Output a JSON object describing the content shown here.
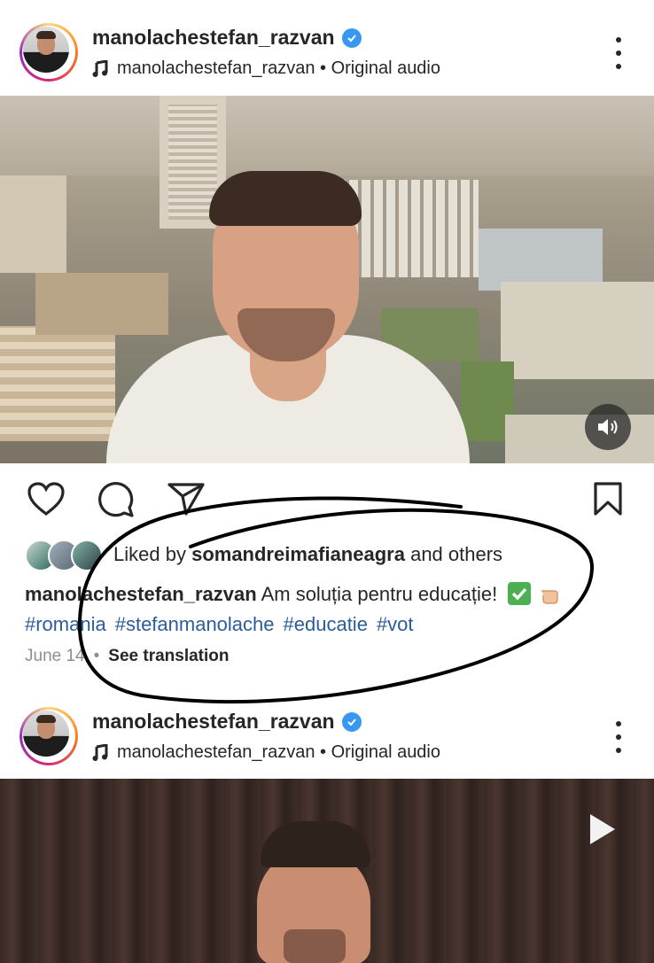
{
  "posts": [
    {
      "username": "manolachestefan_razvan",
      "audio": "manolachestefan_razvan • Original audio"
    },
    {
      "username": "manolachestefan_razvan",
      "audio": "manolachestefan_razvan • Original audio"
    }
  ],
  "likes": {
    "prefix": "Liked by",
    "user": "somandreimafianeagra",
    "suffix": "and others"
  },
  "caption": {
    "author": "manolachestefan_razvan",
    "text": "Am soluția pentru educație!",
    "hashtags": [
      "#romania",
      "#stefanmanolache",
      "#educatie",
      "#vot"
    ]
  },
  "meta": {
    "date": "June 14",
    "separator": "•",
    "see_translation": "See translation"
  },
  "icons": {
    "verified": "verified-badge-icon",
    "music": "music-note-icon",
    "more": "more-vertical-icon",
    "like": "heart-icon",
    "comment": "comment-icon",
    "share": "share-icon",
    "save": "bookmark-icon",
    "audio": "speaker-icon",
    "play": "play-icon"
  },
  "colors": {
    "verified": "#3897f0",
    "hashtag": "#2a5d99",
    "meta": "#8e8e8e",
    "annotation": "#000000"
  }
}
